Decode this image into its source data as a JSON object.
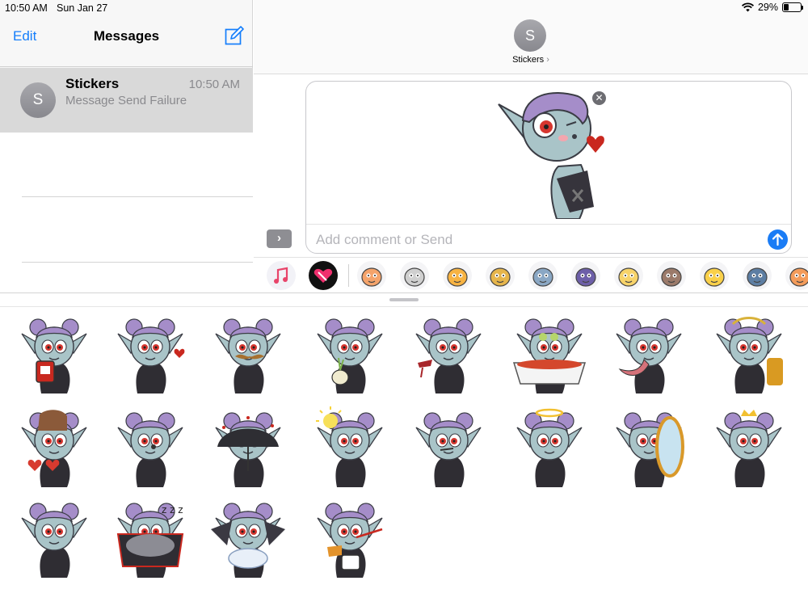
{
  "status_bar": {
    "time": "10:50 AM",
    "date": "Sun Jan 27",
    "battery_percent": "29%",
    "battery_level": 0.29
  },
  "sidebar": {
    "edit_label": "Edit",
    "title": "Messages",
    "conversations": [
      {
        "name": "Stickers",
        "initial": "S",
        "time": "10:50 AM",
        "preview": "Message Send Failure"
      }
    ]
  },
  "chat": {
    "contact_initial": "S",
    "contact_name": "Stickers",
    "comment_placeholder": "Add comment or Send"
  },
  "colors": {
    "accent": "#147efb",
    "selected_row": "#d9d9d9",
    "send": "#1a7cf5"
  },
  "app_drawer": {
    "apps": [
      "music-app",
      "digital-touch-app",
      "bear-sticker-app",
      "cat-sticker-app",
      "fox-sticker-app",
      "monster-sticker-app",
      "bat-sticker-app",
      "clown-sticker-app",
      "sun-sticker-app",
      "raccoon-sticker-app",
      "chick-sticker-app",
      "person-sticker-app",
      "fox2-sticker-app"
    ]
  },
  "stickers": [
    "vampire-blood-bag",
    "vampire-kiss",
    "vampire-mustache",
    "vampire-garlic",
    "vampire-wine",
    "vampire-bath",
    "vampire-tongue",
    "vampire-laurel",
    "vampire-hearts",
    "vampire-whistle",
    "vampire-umbrella",
    "vampire-sun",
    "vampire-smirk",
    "vampire-halo",
    "vampire-mirror",
    "vampire-crown",
    "vampire-stare",
    "vampire-coffin-sleep",
    "vampire-bat",
    "vampire-sick"
  ]
}
